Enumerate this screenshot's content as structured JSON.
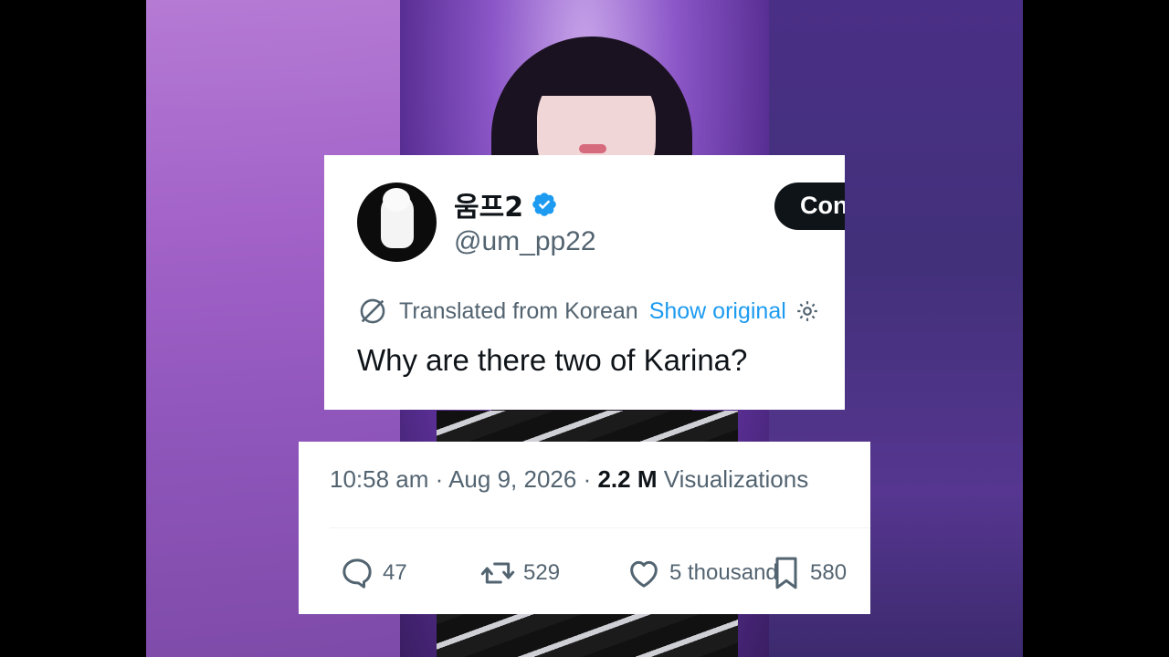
{
  "tweet": {
    "display_name": "움프2",
    "handle": "@um_pp22",
    "follow_button_label": "Con",
    "translated_label": "Translated from Korean",
    "show_original_label": "Show original",
    "text": "Why are there two of Karina?"
  },
  "meta": {
    "time": "10:58 am",
    "date": "Aug 9, 2026",
    "views_count": "2.2 M",
    "views_label": "Visualizations"
  },
  "actions": {
    "replies": "47",
    "retweets": "529",
    "likes": "5 thousand",
    "bookmarks": "580"
  },
  "colors": {
    "verified_blue": "#1d9bf0",
    "text_primary": "#0f1419",
    "text_secondary": "#536471",
    "link_blue": "#1d9bf0"
  },
  "icons": [
    "verified-badge-icon",
    "translate-icon",
    "gear-icon",
    "reply-icon",
    "retweet-icon",
    "like-icon",
    "bookmark-icon"
  ]
}
